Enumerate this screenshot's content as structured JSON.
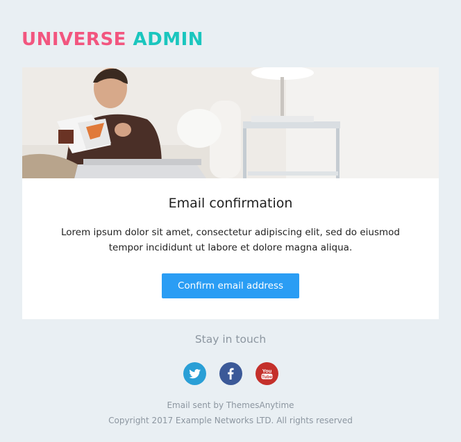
{
  "brand": {
    "word1": "UNIVERSE",
    "word2": "ADMIN",
    "color1": "#f2567f",
    "color2": "#1bc6be"
  },
  "hero": {
    "image": "man-reading-magazine-photo"
  },
  "email": {
    "title": "Email confirmation",
    "body": "Lorem ipsum dolor sit amet, consectetur adipiscing elit, sed do eiusmod tempor incididunt ut labore et dolore magna aliqua.",
    "button_label": "Confirm email address",
    "button_color": "#2a9df4"
  },
  "footer": {
    "stay_in_touch": "Stay in touch",
    "social": [
      {
        "name": "twitter",
        "icon": "twitter-icon",
        "color": "#2a9fd6"
      },
      {
        "name": "facebook",
        "icon": "facebook-icon",
        "color": "#3b5998"
      },
      {
        "name": "youtube",
        "icon": "youtube-icon",
        "color": "#c4302b",
        "text_top": "You",
        "text_bottom": "Tube"
      }
    ],
    "sent_by": "Email sent by ThemesAnytime",
    "copyright": "Copyright 2017 Example Networks LTD. All rights reserved"
  }
}
